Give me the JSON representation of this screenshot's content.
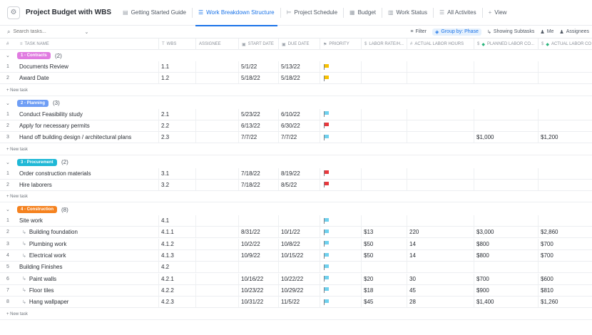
{
  "app": {
    "title": "Project Budget with WBS",
    "icon": "gear-icon"
  },
  "tabs": [
    {
      "label": "Getting Started Guide",
      "icon": "doc-icon",
      "active": false
    },
    {
      "label": "Work Breakdown Structure",
      "icon": "list-icon",
      "active": true
    },
    {
      "label": "Project Schedule",
      "icon": "gantt-icon",
      "active": false
    },
    {
      "label": "Budget",
      "icon": "table-icon",
      "active": false
    },
    {
      "label": "Work Status",
      "icon": "board-icon",
      "active": false
    },
    {
      "label": "All Activites",
      "icon": "list-icon",
      "active": false
    },
    {
      "label": "View",
      "icon": "plus-icon",
      "active": false
    }
  ],
  "toolbar": {
    "search_placeholder": "Search tasks...",
    "filter": "Filter",
    "group_by": "Group by: Phase",
    "subtasks": "Showing Subtasks",
    "me": "Me",
    "assignees": "Assignees"
  },
  "columns": {
    "num": "#",
    "task_name": "TASK NAME",
    "wbs": "WBS",
    "assignee": "ASSIGNEE",
    "start": "START DATE",
    "due": "DUE DATE",
    "priority": "PRIORITY",
    "labor_rate": "LABOR RATE/H...",
    "actual_hours": "ACTUAL LABOR HOURS",
    "planned_cost": "PLANNED LABOR CO...",
    "actual_cost": "ACTUAL LABOR CO"
  },
  "new_task_label": "+ New task",
  "groups": [
    {
      "label": "1 - Contracts",
      "color": "#e07be0",
      "count": "(2)",
      "rows": [
        {
          "num": "1",
          "name": "Documents Review",
          "sub": false,
          "wbs": "1.1",
          "start": "5/1/22",
          "due": "5/13/22",
          "flag": "yellow",
          "rate": "",
          "hours": "",
          "planned": "",
          "actual": ""
        },
        {
          "num": "2",
          "name": "Award Date",
          "sub": false,
          "wbs": "1.2",
          "start": "5/18/22",
          "due": "5/18/22",
          "flag": "yellow",
          "rate": "",
          "hours": "",
          "planned": "",
          "actual": ""
        }
      ]
    },
    {
      "label": "2 - Planning",
      "color": "#6f9ef5",
      "count": "(3)",
      "rows": [
        {
          "num": "1",
          "name": "Conduct Feasibility study",
          "sub": false,
          "wbs": "2.1",
          "start": "5/23/22",
          "due": "6/10/22",
          "flag": "blue",
          "rate": "",
          "hours": "",
          "planned": "",
          "actual": ""
        },
        {
          "num": "2",
          "name": "Apply for necessary permits",
          "sub": false,
          "wbs": "2.2",
          "start": "6/13/22",
          "due": "6/30/22",
          "flag": "red",
          "rate": "",
          "hours": "",
          "planned": "",
          "actual": ""
        },
        {
          "num": "3",
          "name": "Hand off building design / architectural plans",
          "sub": false,
          "wbs": "2.3",
          "start": "7/7/22",
          "due": "7/7/22",
          "flag": "blue",
          "rate": "",
          "hours": "",
          "planned": "$1,000",
          "actual": "$1,200"
        }
      ]
    },
    {
      "label": "3 - Procurement",
      "color": "#1fb8d6",
      "count": "(2)",
      "rows": [
        {
          "num": "1",
          "name": "Order construction materials",
          "sub": false,
          "wbs": "3.1",
          "start": "7/18/22",
          "due": "8/19/22",
          "flag": "red",
          "rate": "",
          "hours": "",
          "planned": "",
          "actual": ""
        },
        {
          "num": "2",
          "name": "Hire laborers",
          "sub": false,
          "wbs": "3.2",
          "start": "7/18/22",
          "due": "8/5/22",
          "flag": "red",
          "rate": "",
          "hours": "",
          "planned": "",
          "actual": ""
        }
      ]
    },
    {
      "label": "4 - Construction",
      "color": "#f5821f",
      "count": "(8)",
      "rows": [
        {
          "num": "1",
          "name": "Site work",
          "sub": false,
          "wbs": "4.1",
          "start": "",
          "due": "",
          "flag": "blue",
          "rate": "",
          "hours": "",
          "planned": "",
          "actual": ""
        },
        {
          "num": "2",
          "name": "Building foundation",
          "sub": true,
          "wbs": "4.1.1",
          "start": "8/31/22",
          "due": "10/1/22",
          "flag": "blue",
          "rate": "$13",
          "hours": "220",
          "planned": "$3,000",
          "actual": "$2,860"
        },
        {
          "num": "3",
          "name": "Plumbing work",
          "sub": true,
          "wbs": "4.1.2",
          "start": "10/2/22",
          "due": "10/8/22",
          "flag": "blue",
          "rate": "$50",
          "hours": "14",
          "planned": "$800",
          "actual": "$700"
        },
        {
          "num": "4",
          "name": "Electrical work",
          "sub": true,
          "wbs": "4.1.3",
          "start": "10/9/22",
          "due": "10/15/22",
          "flag": "blue",
          "rate": "$50",
          "hours": "14",
          "planned": "$800",
          "actual": "$700"
        },
        {
          "num": "5",
          "name": "Building Finishes",
          "sub": false,
          "wbs": "4.2",
          "start": "",
          "due": "",
          "flag": "blue",
          "rate": "",
          "hours": "",
          "planned": "",
          "actual": ""
        },
        {
          "num": "6",
          "name": "Paint walls",
          "sub": true,
          "wbs": "4.2.1",
          "start": "10/16/22",
          "due": "10/22/22",
          "flag": "blue",
          "rate": "$20",
          "hours": "30",
          "planned": "$700",
          "actual": "$600"
        },
        {
          "num": "7",
          "name": "Floor tiles",
          "sub": true,
          "wbs": "4.2.2",
          "start": "10/23/22",
          "due": "10/29/22",
          "flag": "blue",
          "rate": "$18",
          "hours": "45",
          "planned": "$900",
          "actual": "$810"
        },
        {
          "num": "8",
          "name": "Hang wallpaper",
          "sub": true,
          "wbs": "4.2.3",
          "start": "10/31/22",
          "due": "11/5/22",
          "flag": "blue",
          "rate": "$45",
          "hours": "28",
          "planned": "$1,400",
          "actual": "$1,260"
        }
      ]
    }
  ]
}
